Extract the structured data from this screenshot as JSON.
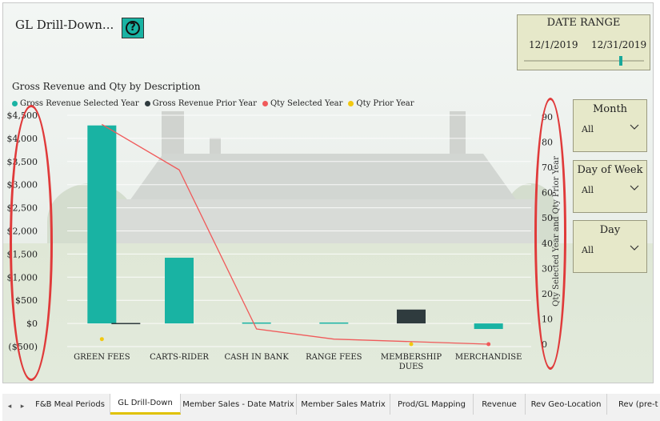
{
  "header": {
    "title": "GL Drill-Down...",
    "help_icon": "question-circle-icon",
    "help_glyph": "?"
  },
  "date_range": {
    "label": "DATE RANGE",
    "start": "12/1/2019",
    "end": "12/31/2019"
  },
  "slicers": [
    {
      "label": "Month",
      "value": "All"
    },
    {
      "label": "Day of Week",
      "value": "All"
    },
    {
      "label": "Day",
      "value": "All"
    }
  ],
  "chart_title": "Gross Revenue and Qty by Description",
  "legend": [
    {
      "label": "Gross Revenue Selected Year",
      "color": "#19b3a3"
    },
    {
      "label": "Gross Revenue Prior Year",
      "color": "#2f3b3e"
    },
    {
      "label": "Qty Selected Year",
      "color": "#f05a5a"
    },
    {
      "label": "Qty Prior Year",
      "color": "#f2c80f"
    }
  ],
  "chart_data": {
    "type": "bar",
    "title": "Gross Revenue and Qty by Description",
    "categories": [
      "GREEN FEES",
      "CARTS-RIDER",
      "CASH IN BANK",
      "RANGE FEES",
      "MEMBERSHIP DUES",
      "MERCHANDISE"
    ],
    "category_lines": [
      [
        "GREEN FEES"
      ],
      [
        "CARTS-RIDER"
      ],
      [
        "CASH IN BANK"
      ],
      [
        "RANGE FEES"
      ],
      [
        "MEMBERSHIP",
        "DUES"
      ],
      [
        "MERCHANDISE"
      ]
    ],
    "series": [
      {
        "name": "Gross Revenue Selected Year",
        "values": [
          4280,
          1420,
          20,
          20,
          null,
          -120
        ],
        "axis": "left",
        "kind": "bar"
      },
      {
        "name": "Gross Revenue Prior Year",
        "values": [
          10,
          null,
          null,
          null,
          300,
          null
        ],
        "axis": "left",
        "kind": "bar"
      },
      {
        "name": "Qty Selected Year",
        "values": [
          87,
          69,
          6,
          2,
          null,
          0
        ],
        "axis": "right",
        "kind": "line"
      },
      {
        "name": "Qty Prior Year",
        "values": [
          2,
          null,
          null,
          null,
          0,
          null
        ],
        "axis": "right",
        "kind": "point"
      }
    ],
    "y_left": {
      "ticks": [
        "$4,500",
        "$4,000",
        "$3,500",
        "$3,000",
        "$2,500",
        "$2,000",
        "$1,500",
        "$1,000",
        "$500",
        "$0",
        "($500)"
      ],
      "min": -500,
      "max": 4500
    },
    "y_right": {
      "label": "Qty Selected Year and Qty Prior Year",
      "ticks": [
        "90",
        "80",
        "70",
        "60",
        "50",
        "40",
        "30",
        "20",
        "10",
        "0"
      ],
      "min": 0,
      "max": 90
    },
    "grid": true
  },
  "tabs": [
    {
      "label": "F&B Meal Periods",
      "active": false
    },
    {
      "label": "GL Drill-Down",
      "active": true
    },
    {
      "label": "Member Sales - Date Matrix",
      "active": false
    },
    {
      "label": "Member Sales Matrix",
      "active": false
    },
    {
      "label": "Prod/GL Mapping",
      "active": false
    },
    {
      "label": "Revenue",
      "active": false
    },
    {
      "label": "Rev Geo-Location",
      "active": false
    },
    {
      "label": "Rev (pre-t",
      "active": false
    }
  ],
  "tab_nav": {
    "prev_icon": "triangle-left-icon",
    "next_icon": "triangle-right-icon",
    "prev_glyph": "◂",
    "next_glyph": "▸"
  }
}
